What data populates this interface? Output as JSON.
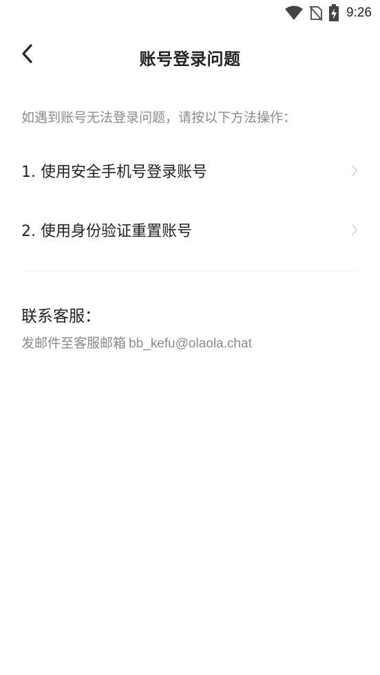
{
  "status_bar": {
    "time": "9:26",
    "icons": [
      "wifi-icon",
      "no-sim-icon",
      "battery-charging-icon"
    ]
  },
  "header": {
    "title": "账号登录问题",
    "back_icon": "chevron-left-icon"
  },
  "main": {
    "intro": "如遇到账号无法登录问题，请按以下方法操作：",
    "options": [
      {
        "label": "1. 使用安全手机号登录账号"
      },
      {
        "label": "2. 使用身份验证重置账号"
      }
    ]
  },
  "contact": {
    "title": "联系客服：",
    "prefix": "发邮件至客服邮箱",
    "email": "bb_kefu@olaola.chat"
  },
  "colors": {
    "text_primary": "#222222",
    "text_secondary": "#8a8a8a",
    "chevron": "#d0d0d0",
    "divider": "#f0f0f0"
  }
}
